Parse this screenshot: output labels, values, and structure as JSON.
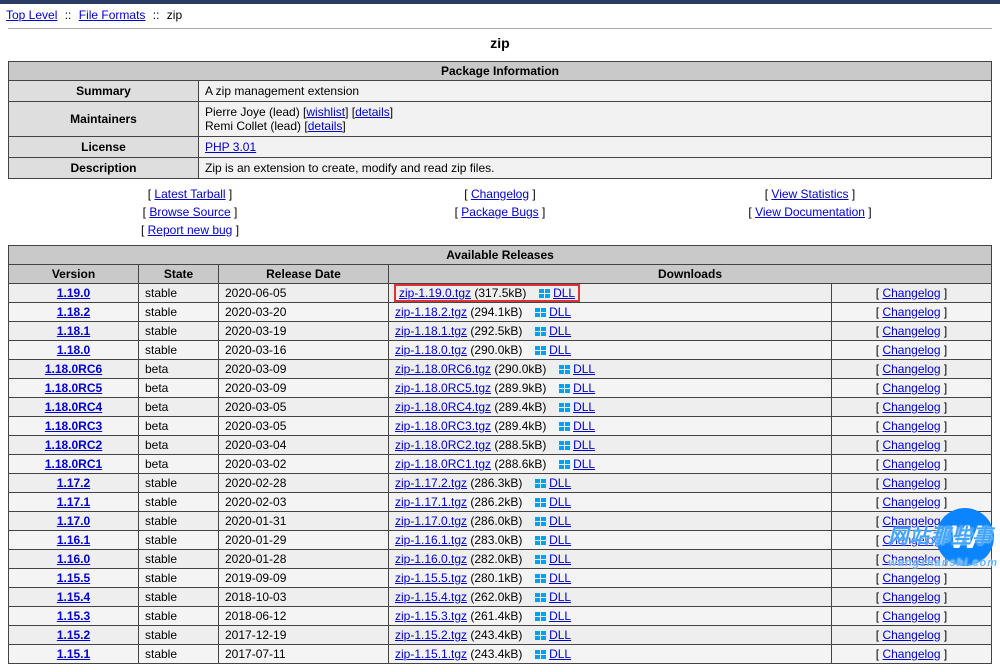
{
  "breadcrumbs": {
    "top": "Top Level",
    "mid": "File Formats",
    "leaf": "zip",
    "sep": "::"
  },
  "title": "zip",
  "info": {
    "heading": "Package Information",
    "summary_label": "Summary",
    "summary": "A zip management extension",
    "maintainers_label": "Maintainers",
    "maintainer1_name": "Pierre Joye (lead) ",
    "maintainer2_name": "Remi Collet (lead) ",
    "wishlist": "wishlist",
    "details": "details",
    "license_label": "License",
    "license": "PHP 3.01",
    "description_label": "Description",
    "description": "Zip is an extension to create, modify and read zip files."
  },
  "links": {
    "latest_tarball": "Latest Tarball",
    "browse_source": "Browse Source",
    "report_bug": "Report new bug",
    "changelog": "Changelog",
    "package_bugs": "Package Bugs",
    "view_stats": "View Statistics",
    "view_docs": "View Documentation"
  },
  "rel": {
    "heading": "Available Releases",
    "cols": {
      "version": "Version",
      "state": "State",
      "date": "Release Date",
      "downloads": "Downloads"
    },
    "dll": "DLL",
    "chlog": "Changelog",
    "rows": [
      {
        "v": "1.19.0",
        "s": "stable",
        "d": "2020-06-05",
        "f": "zip-1.19.0.tgz",
        "sz": "317.5kB",
        "hl": true
      },
      {
        "v": "1.18.2",
        "s": "stable",
        "d": "2020-03-20",
        "f": "zip-1.18.2.tgz",
        "sz": "294.1kB"
      },
      {
        "v": "1.18.1",
        "s": "stable",
        "d": "2020-03-19",
        "f": "zip-1.18.1.tgz",
        "sz": "292.5kB"
      },
      {
        "v": "1.18.0",
        "s": "stable",
        "d": "2020-03-16",
        "f": "zip-1.18.0.tgz",
        "sz": "290.0kB"
      },
      {
        "v": "1.18.0RC6",
        "s": "beta",
        "d": "2020-03-09",
        "f": "zip-1.18.0RC6.tgz",
        "sz": "290.0kB"
      },
      {
        "v": "1.18.0RC5",
        "s": "beta",
        "d": "2020-03-09",
        "f": "zip-1.18.0RC5.tgz",
        "sz": "289.9kB"
      },
      {
        "v": "1.18.0RC4",
        "s": "beta",
        "d": "2020-03-05",
        "f": "zip-1.18.0RC4.tgz",
        "sz": "289.4kB"
      },
      {
        "v": "1.18.0RC3",
        "s": "beta",
        "d": "2020-03-05",
        "f": "zip-1.18.0RC3.tgz",
        "sz": "289.4kB"
      },
      {
        "v": "1.18.0RC2",
        "s": "beta",
        "d": "2020-03-04",
        "f": "zip-1.18.0RC2.tgz",
        "sz": "288.5kB"
      },
      {
        "v": "1.18.0RC1",
        "s": "beta",
        "d": "2020-03-02",
        "f": "zip-1.18.0RC1.tgz",
        "sz": "288.6kB"
      },
      {
        "v": "1.17.2",
        "s": "stable",
        "d": "2020-02-28",
        "f": "zip-1.17.2.tgz",
        "sz": "286.3kB"
      },
      {
        "v": "1.17.1",
        "s": "stable",
        "d": "2020-02-03",
        "f": "zip-1.17.1.tgz",
        "sz": "286.2kB"
      },
      {
        "v": "1.17.0",
        "s": "stable",
        "d": "2020-01-31",
        "f": "zip-1.17.0.tgz",
        "sz": "286.0kB"
      },
      {
        "v": "1.16.1",
        "s": "stable",
        "d": "2020-01-29",
        "f": "zip-1.16.1.tgz",
        "sz": "283.0kB"
      },
      {
        "v": "1.16.0",
        "s": "stable",
        "d": "2020-01-28",
        "f": "zip-1.16.0.tgz",
        "sz": "282.0kB"
      },
      {
        "v": "1.15.5",
        "s": "stable",
        "d": "2019-09-09",
        "f": "zip-1.15.5.tgz",
        "sz": "280.1kB"
      },
      {
        "v": "1.15.4",
        "s": "stable",
        "d": "2018-10-03",
        "f": "zip-1.15.4.tgz",
        "sz": "262.0kB"
      },
      {
        "v": "1.15.3",
        "s": "stable",
        "d": "2018-06-12",
        "f": "zip-1.15.3.tgz",
        "sz": "261.4kB"
      },
      {
        "v": "1.15.2",
        "s": "stable",
        "d": "2017-12-19",
        "f": "zip-1.15.2.tgz",
        "sz": "243.4kB"
      },
      {
        "v": "1.15.1",
        "s": "stable",
        "d": "2017-07-11",
        "f": "zip-1.15.1.tgz",
        "sz": "243.4kB"
      }
    ]
  },
  "watermark": {
    "letter": "W",
    "text": "网站那些事",
    "domain": "wangzhanshi.com"
  }
}
